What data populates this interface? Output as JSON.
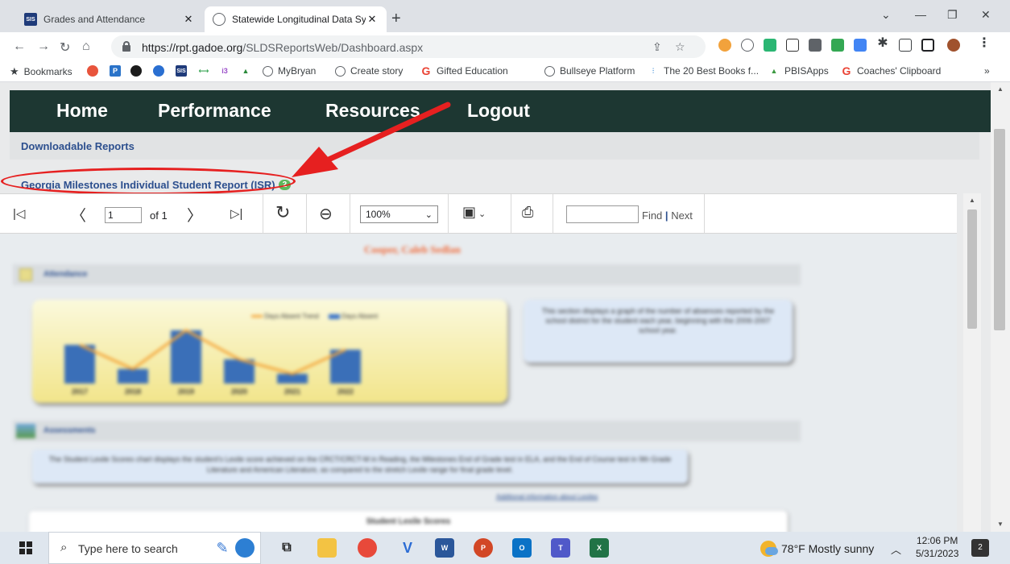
{
  "browser": {
    "tabs": [
      {
        "favicon": "sis-icon",
        "title": "Grades and Attendance",
        "active": false
      },
      {
        "favicon": "globe-icon",
        "title": "Statewide Longitudinal Data Syst",
        "active": true
      }
    ],
    "url_scheme_host": "https://rpt.gadoe.org",
    "url_path": "/SLDSReportsWeb/Dashboard.aspx",
    "bookmarks_label": "Bookmarks",
    "bookmarks": [
      {
        "label": "MyBryan",
        "icon": "globe-icon"
      },
      {
        "label": "Create story",
        "icon": "globe-icon"
      },
      {
        "label": "Gifted Education",
        "icon": "google-icon"
      },
      {
        "label": "Bullseye Platform",
        "icon": "globe-icon"
      },
      {
        "label": "The 20 Best Books f...",
        "icon": "book-icon"
      },
      {
        "label": "PBISApps",
        "icon": "pbis-icon"
      },
      {
        "label": "Coaches' Clipboard",
        "icon": "google-icon"
      }
    ],
    "bookmarks_overflow": "»"
  },
  "site": {
    "nav": [
      "Home",
      "Performance",
      "Resources",
      "Logout"
    ],
    "downloadable_reports": "Downloadable Reports",
    "isr_link": "Georgia Milestones Individual Student Report (ISR)",
    "isr_badge": "2"
  },
  "report_viewer": {
    "page_value": "1",
    "page_of": "of 1",
    "zoom": "100%",
    "find": "Find",
    "find_sep": "|",
    "next": "Next"
  },
  "report": {
    "student_name": "Cooper, Caleb Sedlan",
    "attendance_heading": "Attendance",
    "legend": [
      "Days Absent Trend",
      "Days Absent"
    ],
    "chart_data": {
      "type": "bar",
      "categories": [
        "2017",
        "2018",
        "2019",
        "2020",
        "2021",
        "2022"
      ],
      "values": [
        8,
        3,
        11,
        5,
        2,
        7
      ],
      "series_line": [
        8,
        3,
        11,
        5,
        2,
        7
      ]
    },
    "attendance_note": "This section displays a graph of the number of absences reported by the school district for the student each year, beginning with the 2006-2007 school year.",
    "assessments_heading": "Assessments",
    "assessments_note": "The Student Lexile Scores chart displays the student's Lexile score achieved on the CRCT/CRCT-M in Reading, the Milestones End of Grade test in ELA, and the End of Course test in 9th Grade Literature and American Literature, as compared to the stretch Lexile range for final grade level.",
    "lexile_link": "Additional information about Lexiles",
    "lexile_chart_title": "Student Lexile Scores"
  },
  "taskbar": {
    "search_placeholder": "Type here to search",
    "weather": "78°F  Mostly sunny",
    "time": "12:06 PM",
    "date": "5/31/2023",
    "notifications": "2"
  },
  "colors": {
    "nav_bg": "#1d3732",
    "link_blue": "#2c4f8e",
    "annotation_red": "#e62020",
    "badge_green": "#5cb85c"
  }
}
